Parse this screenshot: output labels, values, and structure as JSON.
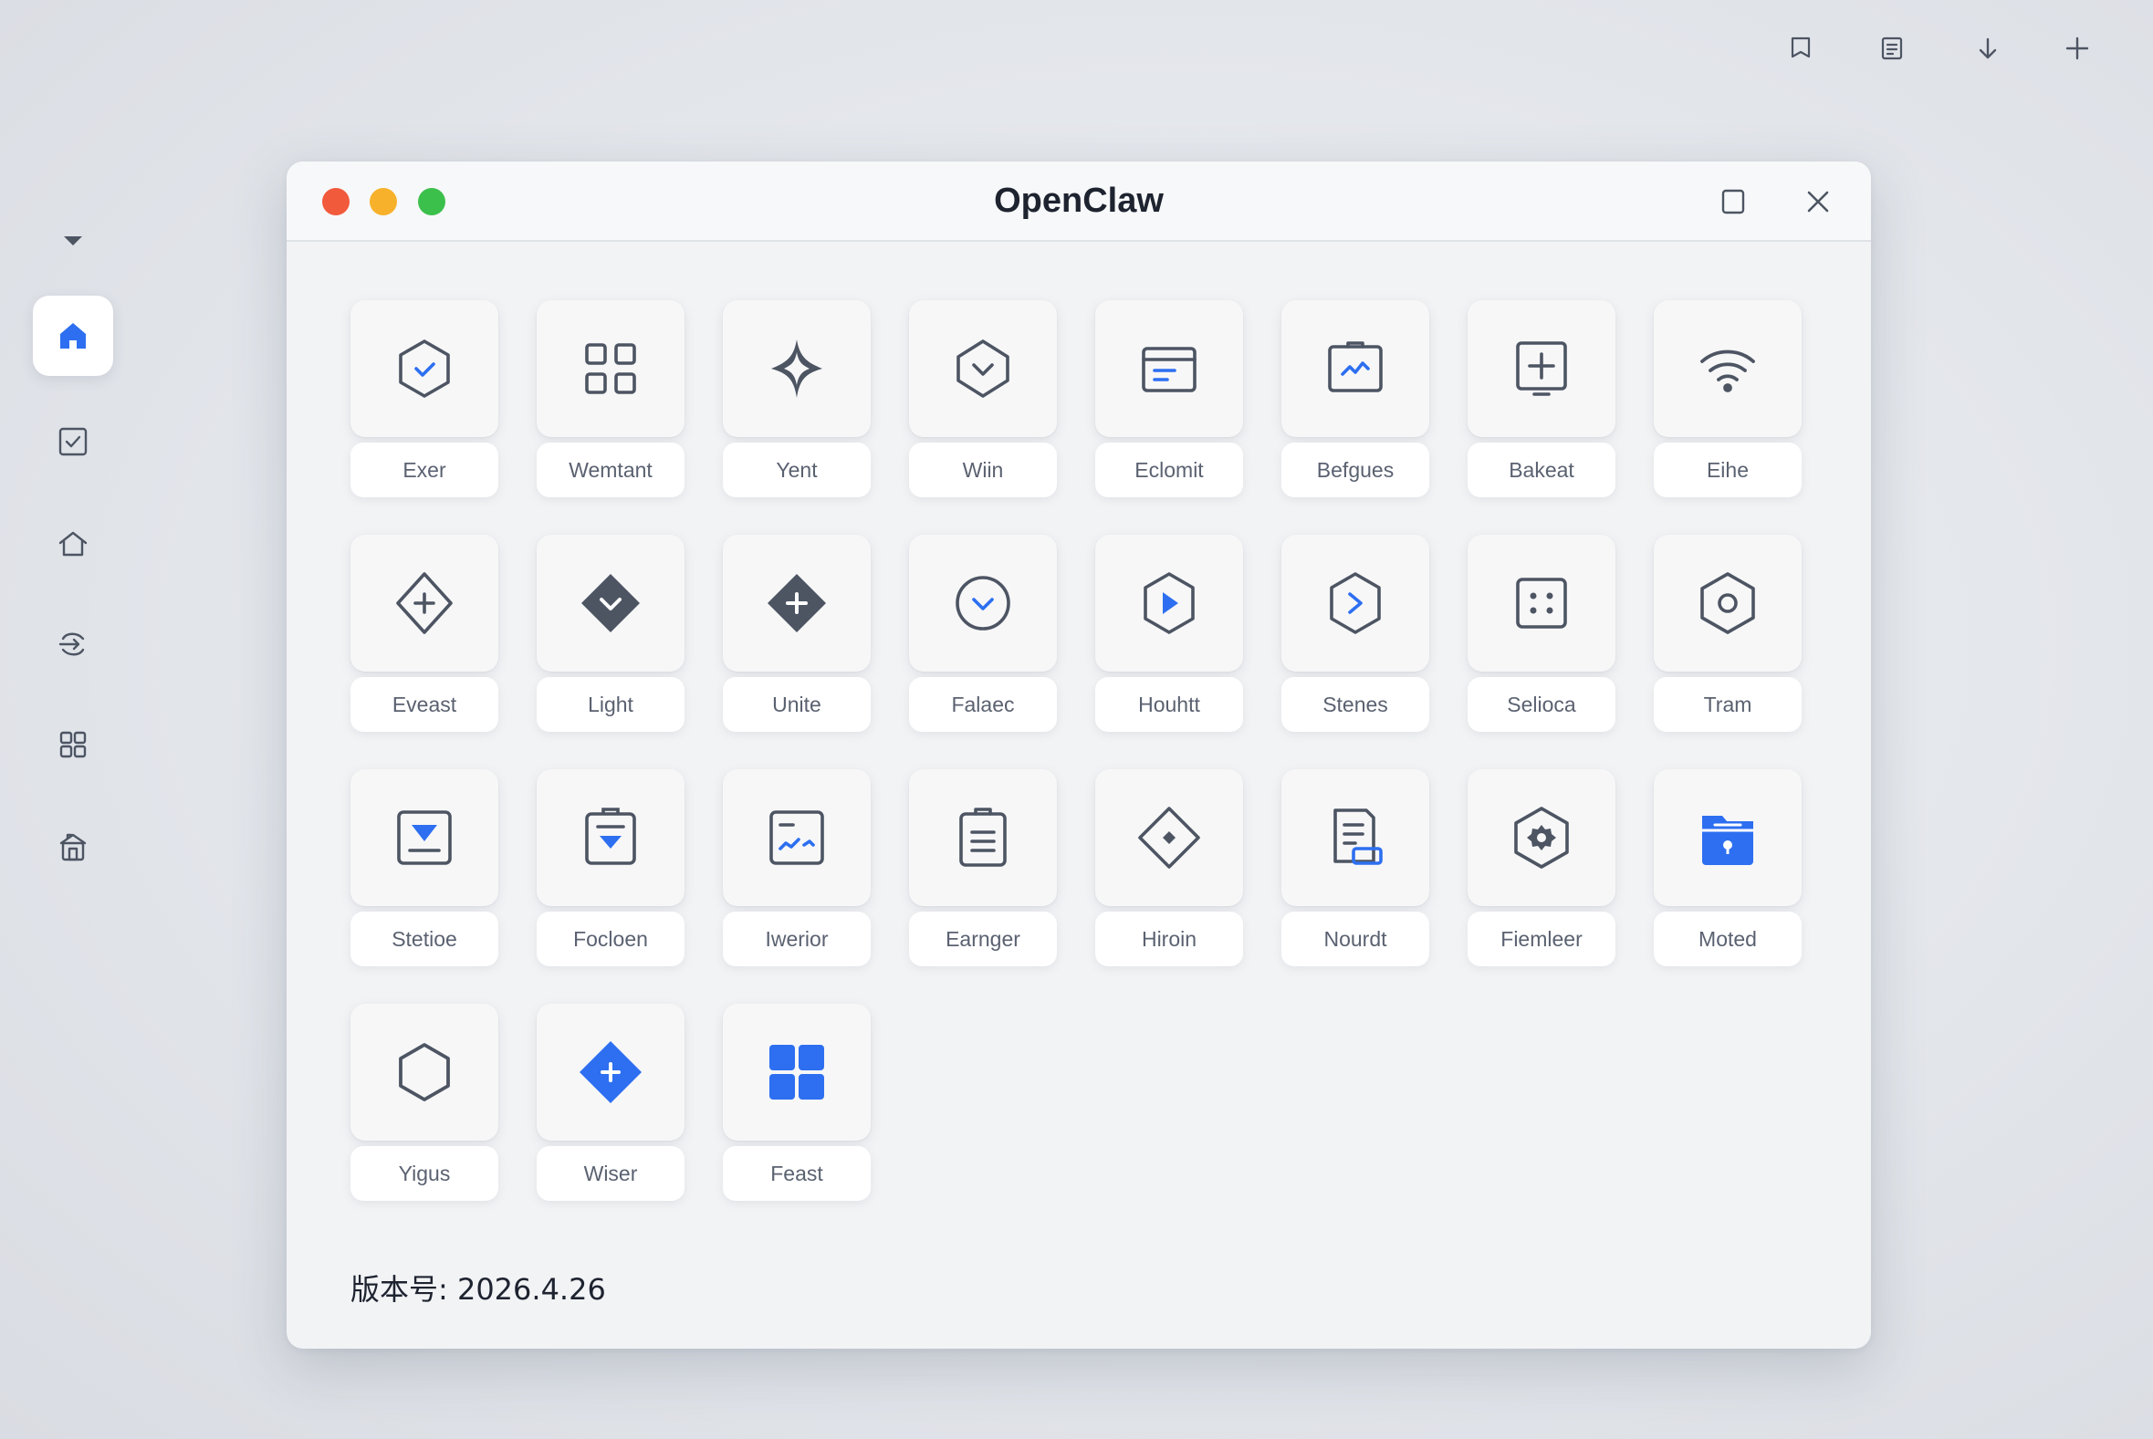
{
  "window": {
    "title": "OpenClaw"
  },
  "version": {
    "label": "版本号: 2026.4.26"
  },
  "colors": {
    "accent": "#2d6ff0",
    "icon": "#4d5563",
    "close_dot": "#f25a3c",
    "minimize_dot": "#f7b12a",
    "zoom_dot": "#3cc04c",
    "window_bg": "#f2f3f5"
  },
  "toolbar": [
    {
      "icon": "bookmark-icon"
    },
    {
      "icon": "document-icon"
    },
    {
      "icon": "download-arrow-icon"
    },
    {
      "icon": "plus-icon"
    }
  ],
  "sidebar": [
    {
      "icon": "dropdown-caret-icon",
      "active": false
    },
    {
      "icon": "home-icon",
      "active": true
    },
    {
      "icon": "checkbox-icon",
      "active": false
    },
    {
      "icon": "house-outline-icon",
      "active": false
    },
    {
      "icon": "share-icon",
      "active": false
    },
    {
      "icon": "grid-icon",
      "active": false
    },
    {
      "icon": "building-icon",
      "active": false
    }
  ],
  "apps": [
    {
      "label": "Exer",
      "icon": "hexagon-check-icon"
    },
    {
      "label": "Wemtant",
      "icon": "grid-four-icon"
    },
    {
      "label": "Yent",
      "icon": "sparkle-icon"
    },
    {
      "label": "Wiin",
      "icon": "hexagon-check-outline-icon"
    },
    {
      "label": "Eclomit",
      "icon": "folder-card-icon"
    },
    {
      "label": "Befgues",
      "icon": "clipboard-chart-icon"
    },
    {
      "label": "Bakeat",
      "icon": "plus-monitor-icon"
    },
    {
      "label": "Eihe",
      "icon": "wifi-icon"
    },
    {
      "label": "Eveast",
      "icon": "hexagon-plus-icon"
    },
    {
      "label": "Light",
      "icon": "diamond-check-icon"
    },
    {
      "label": "Unite",
      "icon": "diamond-plus-icon"
    },
    {
      "label": "Falaec",
      "icon": "circle-check-icon"
    },
    {
      "label": "Houhtt",
      "icon": "hexagon-play-icon"
    },
    {
      "label": "Stenes",
      "icon": "hexagon-chevron-icon"
    },
    {
      "label": "Selioca",
      "icon": "dice-icon"
    },
    {
      "label": "Tram",
      "icon": "hexagon-ring-icon"
    },
    {
      "label": "Stetioe",
      "icon": "inbox-download-icon"
    },
    {
      "label": "Focloen",
      "icon": "clipboard-download-icon"
    },
    {
      "label": "Iwerior",
      "icon": "window-graph-icon"
    },
    {
      "label": "Earnger",
      "icon": "clipboard-list-icon"
    },
    {
      "label": "Hiroin",
      "icon": "diamond-dot-icon"
    },
    {
      "label": "Nourdt",
      "icon": "document-card-icon"
    },
    {
      "label": "Fiemleer",
      "icon": "hexagon-gear-icon"
    },
    {
      "label": "Moted",
      "icon": "blue-folder-lock-icon"
    },
    {
      "label": "Yigus",
      "icon": "hexagon-outline-icon"
    },
    {
      "label": "Wiser",
      "icon": "blue-diamond-plus-icon"
    },
    {
      "label": "Feast",
      "icon": "blue-grid-icon"
    }
  ]
}
